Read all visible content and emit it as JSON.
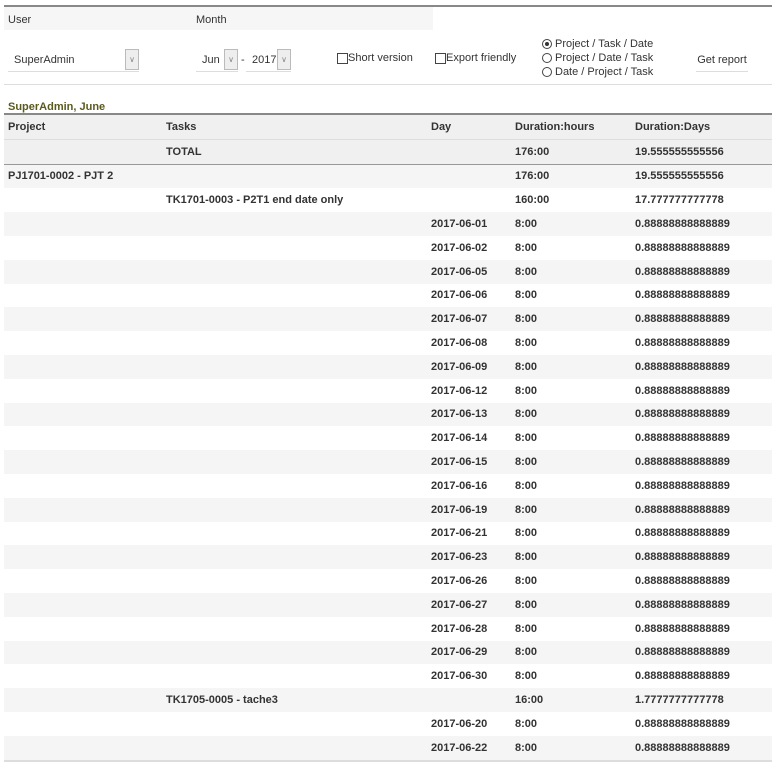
{
  "filters": {
    "user_label": "User",
    "month_label": "Month",
    "user": "SuperAdmin",
    "month": "Jun",
    "separator": "-",
    "year": "2017",
    "short_version": "Short version",
    "export_friendly": "Export friendly",
    "group_options": [
      "Project / Task / Date",
      "Project / Date / Task",
      "Date / Project / Task"
    ],
    "selected_group": 0,
    "get_report": "Get report"
  },
  "report_title": "SuperAdmin, June",
  "columns": [
    "Project",
    "Tasks",
    "Day",
    "Duration:hours",
    "Duration:Days"
  ],
  "total": {
    "label": "TOTAL",
    "hours": "176:00",
    "days": "19.555555555556"
  },
  "rows": [
    {
      "project": "PJ1701-0002 - PJT 2",
      "task": "",
      "day": "",
      "hours": "176:00",
      "days": "19.555555555556"
    },
    {
      "project": "",
      "task": "TK1701-0003 - P2T1 end date only",
      "day": "",
      "hours": "160:00",
      "days": "17.777777777778"
    },
    {
      "project": "",
      "task": "",
      "day": "2017-06-01",
      "hours": "8:00",
      "days": "0.88888888888889"
    },
    {
      "project": "",
      "task": "",
      "day": "2017-06-02",
      "hours": "8:00",
      "days": "0.88888888888889"
    },
    {
      "project": "",
      "task": "",
      "day": "2017-06-05",
      "hours": "8:00",
      "days": "0.88888888888889"
    },
    {
      "project": "",
      "task": "",
      "day": "2017-06-06",
      "hours": "8:00",
      "days": "0.88888888888889"
    },
    {
      "project": "",
      "task": "",
      "day": "2017-06-07",
      "hours": "8:00",
      "days": "0.88888888888889"
    },
    {
      "project": "",
      "task": "",
      "day": "2017-06-08",
      "hours": "8:00",
      "days": "0.88888888888889"
    },
    {
      "project": "",
      "task": "",
      "day": "2017-06-09",
      "hours": "8:00",
      "days": "0.88888888888889"
    },
    {
      "project": "",
      "task": "",
      "day": "2017-06-12",
      "hours": "8:00",
      "days": "0.88888888888889"
    },
    {
      "project": "",
      "task": "",
      "day": "2017-06-13",
      "hours": "8:00",
      "days": "0.88888888888889"
    },
    {
      "project": "",
      "task": "",
      "day": "2017-06-14",
      "hours": "8:00",
      "days": "0.88888888888889"
    },
    {
      "project": "",
      "task": "",
      "day": "2017-06-15",
      "hours": "8:00",
      "days": "0.88888888888889"
    },
    {
      "project": "",
      "task": "",
      "day": "2017-06-16",
      "hours": "8:00",
      "days": "0.88888888888889"
    },
    {
      "project": "",
      "task": "",
      "day": "2017-06-19",
      "hours": "8:00",
      "days": "0.88888888888889"
    },
    {
      "project": "",
      "task": "",
      "day": "2017-06-21",
      "hours": "8:00",
      "days": "0.88888888888889"
    },
    {
      "project": "",
      "task": "",
      "day": "2017-06-23",
      "hours": "8:00",
      "days": "0.88888888888889"
    },
    {
      "project": "",
      "task": "",
      "day": "2017-06-26",
      "hours": "8:00",
      "days": "0.88888888888889"
    },
    {
      "project": "",
      "task": "",
      "day": "2017-06-27",
      "hours": "8:00",
      "days": "0.88888888888889"
    },
    {
      "project": "",
      "task": "",
      "day": "2017-06-28",
      "hours": "8:00",
      "days": "0.88888888888889"
    },
    {
      "project": "",
      "task": "",
      "day": "2017-06-29",
      "hours": "8:00",
      "days": "0.88888888888889"
    },
    {
      "project": "",
      "task": "",
      "day": "2017-06-30",
      "hours": "8:00",
      "days": "0.88888888888889"
    },
    {
      "project": "",
      "task": "TK1705-0005 - tache3",
      "day": "",
      "hours": "16:00",
      "days": "1.7777777777778"
    },
    {
      "project": "",
      "task": "",
      "day": "2017-06-20",
      "hours": "8:00",
      "days": "0.88888888888889"
    },
    {
      "project": "",
      "task": "",
      "day": "2017-06-22",
      "hours": "8:00",
      "days": "0.88888888888889"
    }
  ]
}
